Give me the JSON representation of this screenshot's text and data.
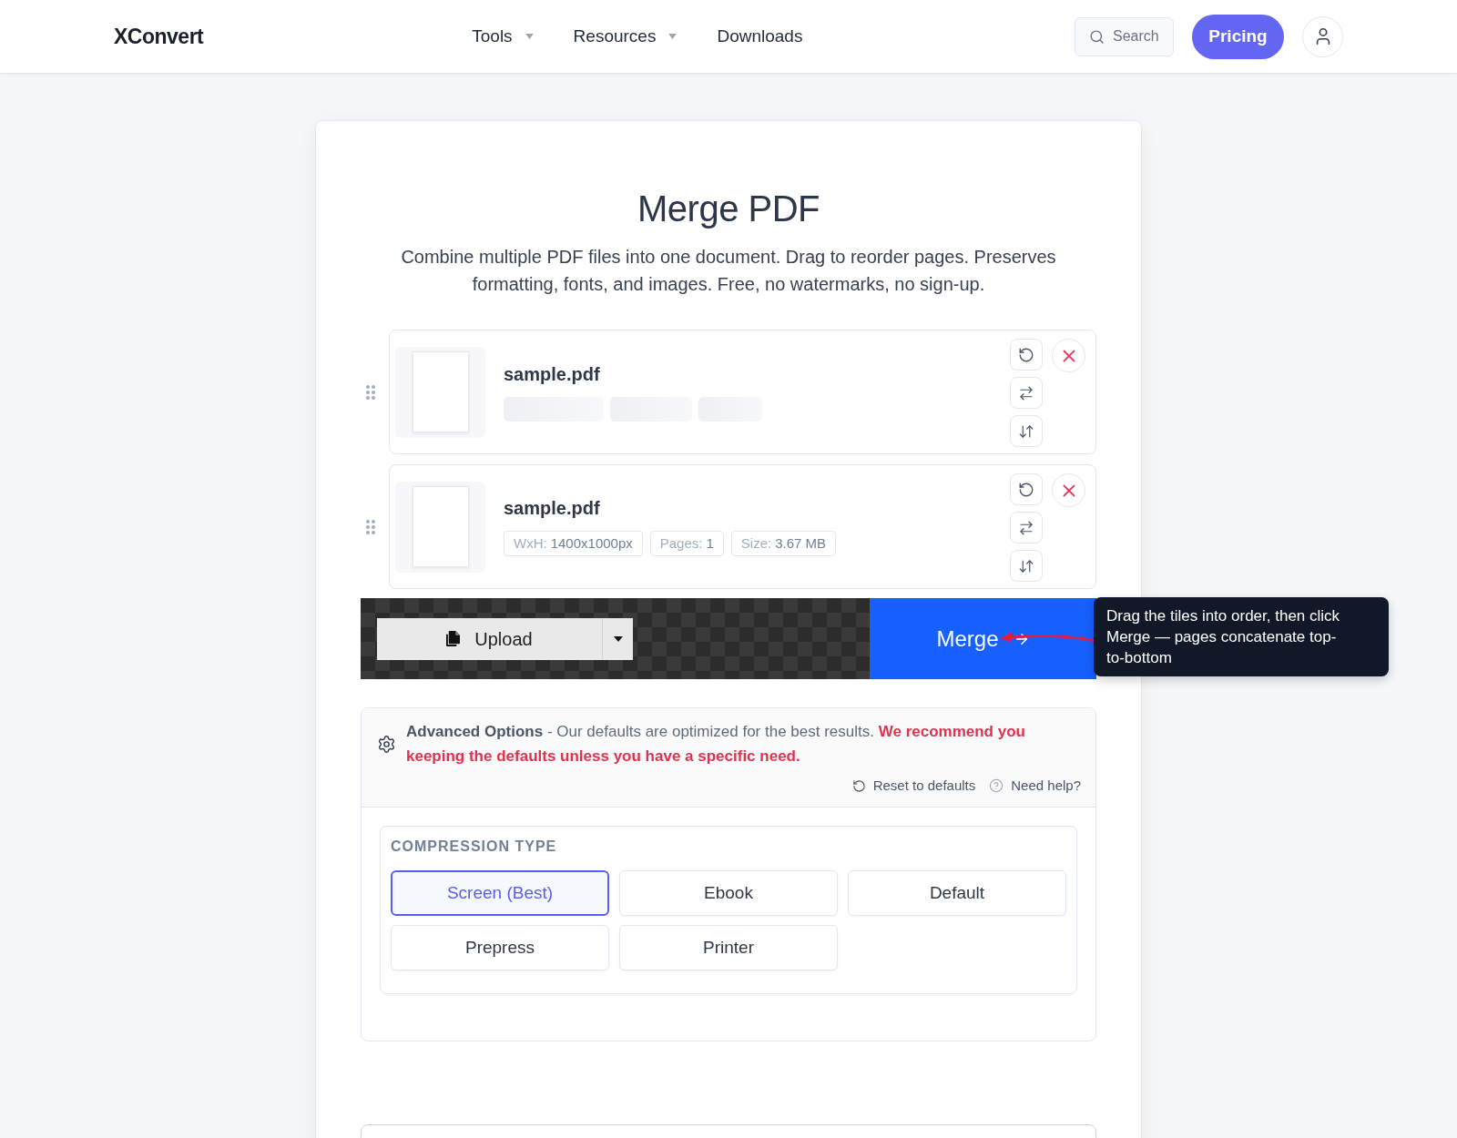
{
  "header": {
    "logo": "XConvert",
    "nav": [
      {
        "label": "Tools",
        "dropdown": true
      },
      {
        "label": "Resources",
        "dropdown": true
      },
      {
        "label": "Downloads",
        "dropdown": false
      }
    ],
    "search": {
      "placeholder": "Search"
    },
    "pricing_button": "Pricing"
  },
  "tool": {
    "title": "Merge PDF",
    "description": "Combine multiple PDF files into one document. Drag to reorder pages. Preserves formatting, fonts, and images. Free, no watermarks, no sign-up."
  },
  "files": [
    {
      "name": "sample.pdf",
      "loading": true
    },
    {
      "name": "sample.pdf",
      "loading": false,
      "meta": [
        {
          "label": "WxH:",
          "value": "1400x1000px"
        },
        {
          "label": "Pages:",
          "value": "1"
        },
        {
          "label": "Size:",
          "value": "3.67 MB"
        }
      ]
    }
  ],
  "action_bar": {
    "upload_button": "Upload",
    "merge_button": "Merge"
  },
  "tooltip": {
    "text": "Drag the tiles into order, then click Merge — pages concatenate top-to-bottom"
  },
  "advanced_options": {
    "title": "Advanced Options",
    "description": "- Our defaults are optimized for the best results.",
    "warning": "We recommend you keeping the defaults unless you have a specific need.",
    "links": [
      {
        "kind": "reset",
        "label": "Reset to defaults"
      },
      {
        "kind": "help",
        "label": "Need help?"
      }
    ]
  },
  "compression": {
    "label": "COMPRESSION TYPE",
    "options": [
      {
        "label": "Screen (Best)",
        "selected": true
      },
      {
        "label": "Ebook",
        "selected": false
      },
      {
        "label": "Default",
        "selected": false
      },
      {
        "label": "Prepress",
        "selected": false
      },
      {
        "label": "Printer",
        "selected": false
      }
    ]
  }
}
